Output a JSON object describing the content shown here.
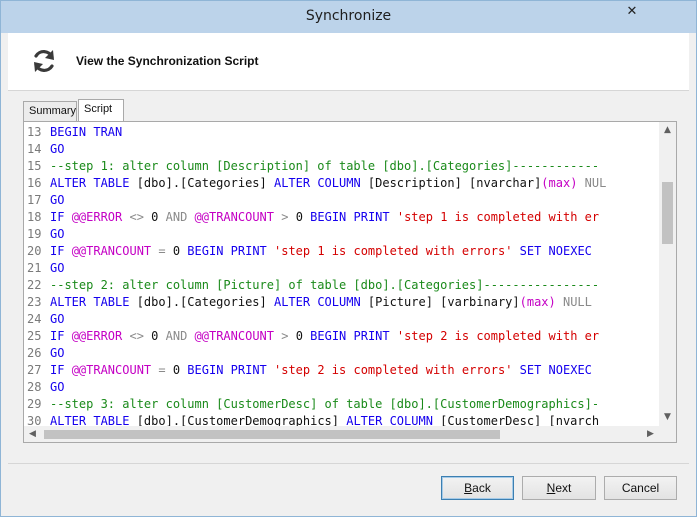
{
  "window": {
    "title": "Synchronize",
    "close_glyph": "✕"
  },
  "header": {
    "icon": "sync-icon",
    "title": "View the Synchronization Script"
  },
  "tabs": [
    {
      "label": "Summary",
      "selected": false
    },
    {
      "label": "Script",
      "selected": true
    }
  ],
  "editor": {
    "lines": [
      {
        "num": "13",
        "tokens": [
          {
            "t": "BEGIN TRAN",
            "c": "kw"
          }
        ]
      },
      {
        "num": "14",
        "tokens": [
          {
            "t": "GO",
            "c": "kw"
          }
        ]
      },
      {
        "num": "15",
        "tokens": [
          {
            "t": "--step 1: alter column [Description] of table [dbo].[Categories]------------",
            "c": "cmt"
          }
        ]
      },
      {
        "num": "16",
        "tokens": [
          {
            "t": "ALTER TABLE ",
            "c": "kw"
          },
          {
            "t": "[dbo].[Categories] ",
            "c": "id"
          },
          {
            "t": "ALTER COLUMN ",
            "c": "kw"
          },
          {
            "t": "[Description] [nvarchar]",
            "c": "id"
          },
          {
            "t": "(max)",
            "c": "fn"
          },
          {
            "t": " NUL",
            "c": "gray"
          }
        ]
      },
      {
        "num": "17",
        "tokens": [
          {
            "t": "GO",
            "c": "kw"
          }
        ]
      },
      {
        "num": "18",
        "tokens": [
          {
            "t": "IF ",
            "c": "kw"
          },
          {
            "t": "@@ERROR ",
            "c": "fn"
          },
          {
            "t": "<> ",
            "c": "gray"
          },
          {
            "t": "0 ",
            "c": "id"
          },
          {
            "t": "AND ",
            "c": "gray"
          },
          {
            "t": "@@TRANCOUNT ",
            "c": "fn"
          },
          {
            "t": "> ",
            "c": "gray"
          },
          {
            "t": "0 ",
            "c": "id"
          },
          {
            "t": "BEGIN PRINT ",
            "c": "kw"
          },
          {
            "t": "'step 1 is completed with er",
            "c": "str"
          }
        ]
      },
      {
        "num": "19",
        "tokens": [
          {
            "t": "GO",
            "c": "kw"
          }
        ]
      },
      {
        "num": "20",
        "tokens": [
          {
            "t": "IF ",
            "c": "kw"
          },
          {
            "t": "@@TRANCOUNT ",
            "c": "fn"
          },
          {
            "t": "= ",
            "c": "gray"
          },
          {
            "t": "0 ",
            "c": "id"
          },
          {
            "t": "BEGIN PRINT ",
            "c": "kw"
          },
          {
            "t": "'step 1 is completed with errors' ",
            "c": "str"
          },
          {
            "t": "SET NOEXEC",
            "c": "kw"
          }
        ]
      },
      {
        "num": "21",
        "tokens": [
          {
            "t": "GO",
            "c": "kw"
          }
        ]
      },
      {
        "num": "22",
        "tokens": [
          {
            "t": "--step 2: alter column [Picture] of table [dbo].[Categories]----------------",
            "c": "cmt"
          }
        ]
      },
      {
        "num": "23",
        "tokens": [
          {
            "t": "ALTER TABLE ",
            "c": "kw"
          },
          {
            "t": "[dbo].[Categories] ",
            "c": "id"
          },
          {
            "t": "ALTER COLUMN ",
            "c": "kw"
          },
          {
            "t": "[Picture] [varbinary]",
            "c": "id"
          },
          {
            "t": "(max)",
            "c": "fn"
          },
          {
            "t": " NULL",
            "c": "gray"
          }
        ]
      },
      {
        "num": "24",
        "tokens": [
          {
            "t": "GO",
            "c": "kw"
          }
        ]
      },
      {
        "num": "25",
        "tokens": [
          {
            "t": "IF ",
            "c": "kw"
          },
          {
            "t": "@@ERROR ",
            "c": "fn"
          },
          {
            "t": "<> ",
            "c": "gray"
          },
          {
            "t": "0 ",
            "c": "id"
          },
          {
            "t": "AND ",
            "c": "gray"
          },
          {
            "t": "@@TRANCOUNT ",
            "c": "fn"
          },
          {
            "t": "> ",
            "c": "gray"
          },
          {
            "t": "0 ",
            "c": "id"
          },
          {
            "t": "BEGIN PRINT ",
            "c": "kw"
          },
          {
            "t": "'step 2 is completed with er",
            "c": "str"
          }
        ]
      },
      {
        "num": "26",
        "tokens": [
          {
            "t": "GO",
            "c": "kw"
          }
        ]
      },
      {
        "num": "27",
        "tokens": [
          {
            "t": "IF ",
            "c": "kw"
          },
          {
            "t": "@@TRANCOUNT ",
            "c": "fn"
          },
          {
            "t": "= ",
            "c": "gray"
          },
          {
            "t": "0 ",
            "c": "id"
          },
          {
            "t": "BEGIN PRINT ",
            "c": "kw"
          },
          {
            "t": "'step 2 is completed with errors' ",
            "c": "str"
          },
          {
            "t": "SET NOEXEC",
            "c": "kw"
          }
        ]
      },
      {
        "num": "28",
        "tokens": [
          {
            "t": "GO",
            "c": "kw"
          }
        ]
      },
      {
        "num": "29",
        "tokens": [
          {
            "t": "--step 3: alter column [CustomerDesc] of table [dbo].[CustomerDemographics]-",
            "c": "cmt"
          }
        ]
      },
      {
        "num": "30",
        "tokens": [
          {
            "t": "ALTER TABLE ",
            "c": "kw"
          },
          {
            "t": "[dbo].[CustomerDemographics] ",
            "c": "id"
          },
          {
            "t": "ALTER COLUMN ",
            "c": "kw"
          },
          {
            "t": "[CustomerDesc] [nvarch",
            "c": "id"
          }
        ]
      }
    ]
  },
  "buttons": {
    "back": {
      "prefix": "",
      "accel": "B",
      "suffix": "ack"
    },
    "next": {
      "prefix": "",
      "accel": "N",
      "suffix": "ext"
    },
    "cancel": {
      "label": "Cancel"
    }
  }
}
